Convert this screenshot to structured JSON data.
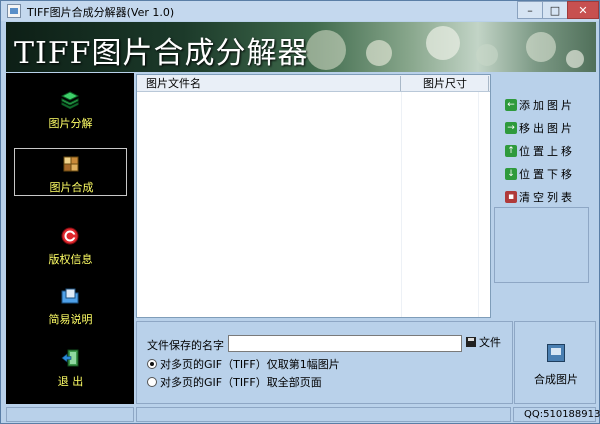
{
  "window": {
    "title": "TIFF图片合成分解器(Ver 1.0)",
    "minimize_label": "–",
    "maximize_label": "□",
    "close_label": "✕"
  },
  "banner": {
    "title": "TIFF图片合成分解器"
  },
  "sidebar": {
    "items": [
      {
        "label": "图片分解",
        "icon": "layers-icon",
        "active": false
      },
      {
        "label": "图片合成",
        "icon": "cubes-icon",
        "active": true
      },
      {
        "label": "版权信息",
        "icon": "copyright-icon",
        "active": false
      },
      {
        "label": "简易说明",
        "icon": "folder-book-icon",
        "active": false
      },
      {
        "label": "退 出",
        "icon": "exit-door-icon",
        "active": false
      }
    ]
  },
  "file_list": {
    "columns": [
      "图片文件名",
      "图片尺寸"
    ],
    "rows": []
  },
  "actions": {
    "add": {
      "label": "添加图片",
      "icon": "arrow-left-icon"
    },
    "remove": {
      "label": "移出图片",
      "icon": "arrow-right-icon"
    },
    "move_up": {
      "label": "位置上移",
      "icon": "arrow-up-icon"
    },
    "move_down": {
      "label": "位置下移",
      "icon": "arrow-down-icon"
    },
    "clear": {
      "label": "清空列表",
      "icon": "book-clear-icon"
    }
  },
  "save": {
    "label": "文件保存的名字",
    "value": "",
    "file_button_label": "文件"
  },
  "options": {
    "first_frame_label": "对多页的GIF（TIFF）仅取第1幅图片",
    "first_frame_checked": true,
    "all_pages_label": "对多页的GIF（TIFF）取全部页面",
    "all_pages_checked": false
  },
  "compose": {
    "label": "合成图片"
  },
  "status": {
    "pane1": "",
    "pane2": "",
    "qq": "QQ:510188913"
  },
  "colors": {
    "window_bg": "#b9d1ea",
    "sidebar_bg": "#000000",
    "sidebar_text": "#ffff66",
    "action_icon": "#2f9a3c"
  }
}
